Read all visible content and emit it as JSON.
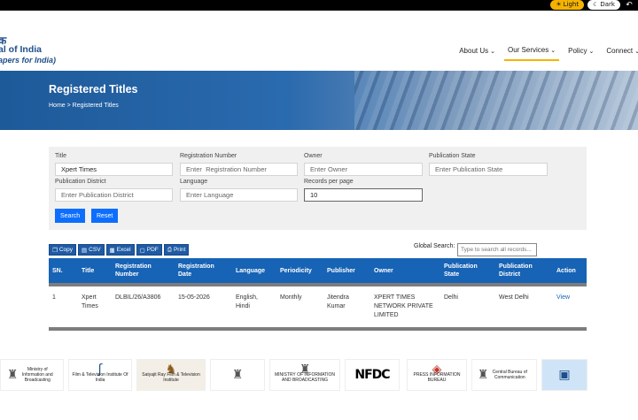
{
  "topbar": {
    "light_label": "Light",
    "dark_label": "Dark"
  },
  "logo": {
    "line1": "क",
    "line2": "al of India",
    "line3": "apers for India)"
  },
  "nav": [
    {
      "label": "About Us"
    },
    {
      "label": "Our Services"
    },
    {
      "label": "Policy"
    },
    {
      "label": "Connect"
    }
  ],
  "banner": {
    "title": "Registered Titles",
    "breadcrumb": "Home > Registered Titles"
  },
  "form": {
    "title_label": "Title",
    "title_value": "Xpert Times",
    "regno_label": "Registration Number",
    "regno_placeholder": "Enter  Registration Number",
    "owner_label": "Owner",
    "owner_placeholder": "Enter Owner",
    "pubstate_label": "Publication State",
    "pubstate_placeholder": "Enter Publication State",
    "pubdistrict_label": "Publication District",
    "pubdistrict_placeholder": "Enter Publication District",
    "language_label": "Language",
    "language_placeholder": "Enter Language",
    "records_label": "Records per page",
    "records_value": "10",
    "search_label": "Search",
    "reset_label": "Reset"
  },
  "toolbar": {
    "copy": "Copy",
    "csv": "CSV",
    "excel": "Excel",
    "pdf": "PDF",
    "print": "Print",
    "global_search_label": "Global Search:",
    "global_search_placeholder": "Type to search all records..."
  },
  "table": {
    "headers": [
      "SN.",
      "Title",
      "Registration Number",
      "Registration Date",
      "Language",
      "Periodicity",
      "Publisher",
      "Owner",
      "Publication State",
      "Publication District",
      "Action"
    ],
    "rows": [
      [
        "1",
        "Xpert Times",
        "DLBIL/26/A3806",
        "15-05-2026",
        "English, Hindi",
        "Monthly",
        "Jitendra Kumar",
        "XPERT TIMES NETWORK PRIVATE LIMITED",
        "Delhi",
        "West Delhi",
        "View"
      ]
    ]
  },
  "footer_logos": [
    "Ministry of Information and Broadcasting",
    "Film & Television Institute Of India",
    "Satyajit Ray Film & Television Institute",
    "",
    "MINISTRY OF INFORMATION AND BROADCASTING",
    "NFDC",
    "PRESS INFORMATION BUREAU",
    "Central Bureau of Communication",
    ""
  ]
}
